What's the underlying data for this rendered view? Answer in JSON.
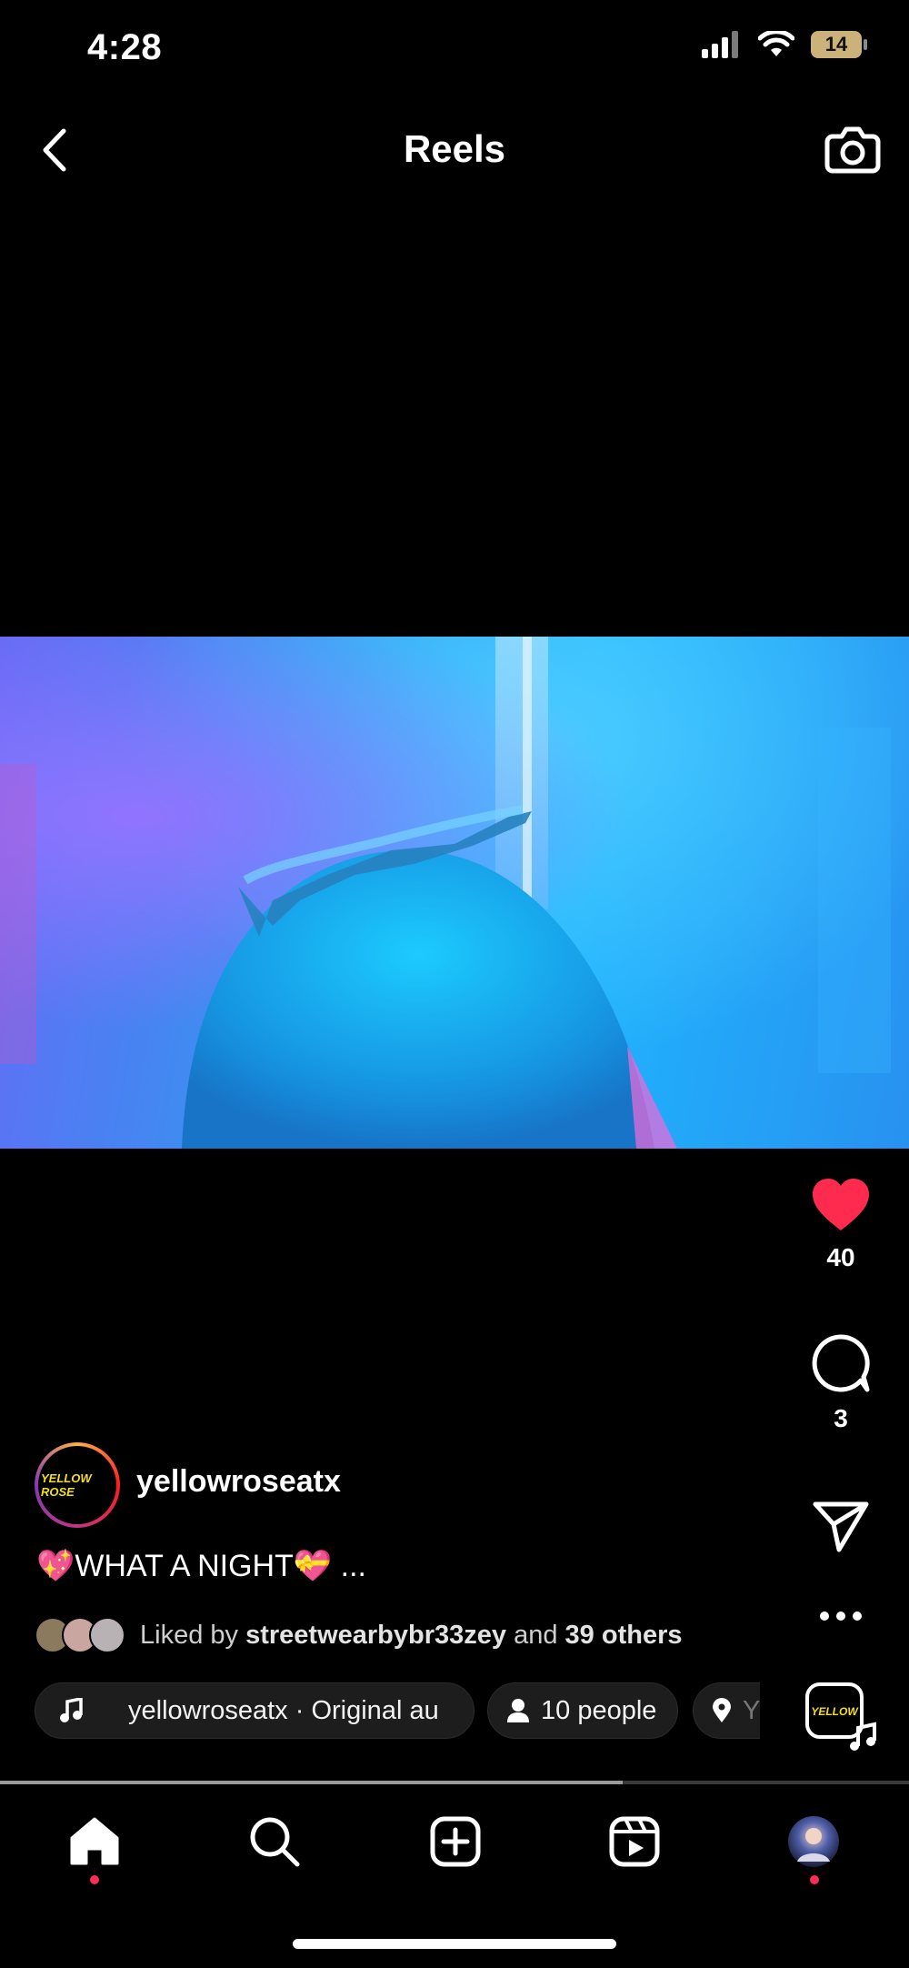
{
  "status_bar": {
    "time": "4:28",
    "battery_level": "14"
  },
  "header": {
    "title": "Reels"
  },
  "video": {
    "description_colors": {
      "accent_blue": "#14b4ff",
      "accent_purple": "#8b6dff"
    }
  },
  "actions": {
    "like_count": "40",
    "comment_count": "3",
    "like_color": "#ff2b4f"
  },
  "post": {
    "avatar_text": "YELLOW ROSE",
    "username": "yellowroseatx",
    "caption": "💖WHAT A NIGHT💝  ...",
    "liked_prefix": "Liked by",
    "liked_user": "streetwearbybr33zey",
    "liked_middle": "and",
    "liked_others": "39 others"
  },
  "chips": {
    "audio": "yellowroseatx · Original au",
    "people": "10 people",
    "location": "Y"
  },
  "progress": {
    "fraction": 0.685
  },
  "tabs": [
    "home",
    "search",
    "create",
    "reels",
    "profile"
  ]
}
